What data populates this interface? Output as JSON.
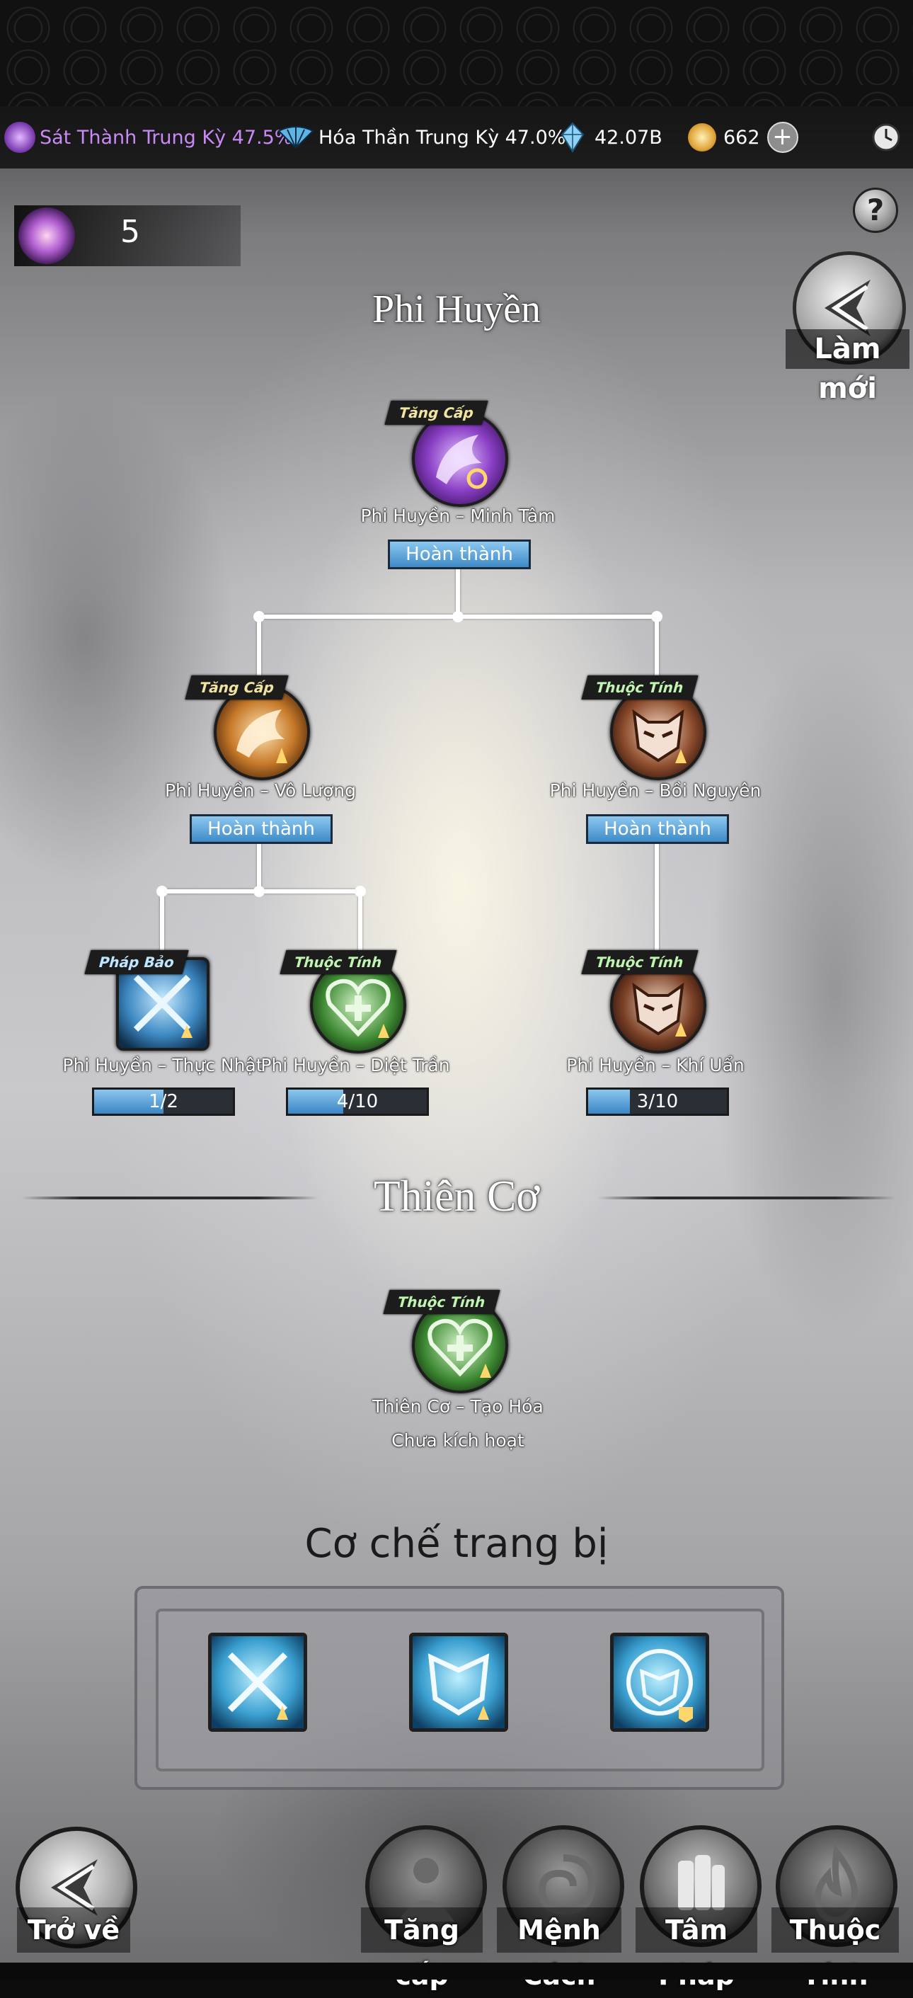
{
  "resource_bar": {
    "realm1": {
      "label": "Sát Thành Trung Kỳ 47.5%",
      "icon": "purple-demon-icon",
      "color": "#c77dff"
    },
    "realm2": {
      "label": "Hóa Thần Trung Kỳ 47.0%",
      "icon": "blue-fan-icon"
    },
    "crystal": {
      "value": "42.07B",
      "icon": "crystal-icon"
    },
    "coin": {
      "value": "662",
      "icon": "gold-coin-icon"
    },
    "add_icon": "plus-icon",
    "clock_icon": "clock-icon"
  },
  "counter": {
    "value": "5",
    "icon": "spirit-orb-icon"
  },
  "help_icon": "question-icon",
  "refresh": {
    "label": "Làm mới",
    "icon": "refresh-arrow-icon"
  },
  "tree_title": "Phi Huyền",
  "nodes": [
    {
      "id": "minh-tam",
      "tag": "Tăng Cấp",
      "name": "Phi Huyền – Minh Tâm",
      "status": "Hoàn thành"
    },
    {
      "id": "vo-luong",
      "tag": "Tăng Cấp",
      "name": "Phi Huyền – Vô Lượng",
      "status": "Hoàn thành"
    },
    {
      "id": "boi-nguyen",
      "tag": "Thuộc Tính",
      "name": "Phi Huyền – Bồi Nguyên",
      "status": "Hoàn thành"
    },
    {
      "id": "thuc-nhat",
      "tag": "Pháp Bảo",
      "name": "Phi Huyền – Thực Nhật",
      "progress": "1/2",
      "ratio": 0.5
    },
    {
      "id": "diet-tran",
      "tag": "Thuộc Tính",
      "name": "Phi Huyền – Diệt Trần",
      "progress": "4/10",
      "ratio": 0.4
    },
    {
      "id": "khi-uan",
      "tag": "Thuộc Tính",
      "name": "Phi Huyền – Khí Uẩn",
      "progress": "3/10",
      "ratio": 0.3
    }
  ],
  "section2": {
    "title": "Thiên Cơ",
    "node": {
      "tag": "Thuộc Tính",
      "name": "Thiên Cơ – Tạo Hóa",
      "status": "Chưa kích hoạt"
    }
  },
  "equipment": {
    "title": "Cơ chế trang bị",
    "slots": [
      "crossed-swords-icon",
      "blue-mask-icon",
      "shield-mask-icon"
    ]
  },
  "bottom_nav": {
    "back": "Trở về",
    "items": [
      "Tăng cấp",
      "Mệnh Cách",
      "Tâm Pháp",
      "Thuộc Tính"
    ]
  }
}
